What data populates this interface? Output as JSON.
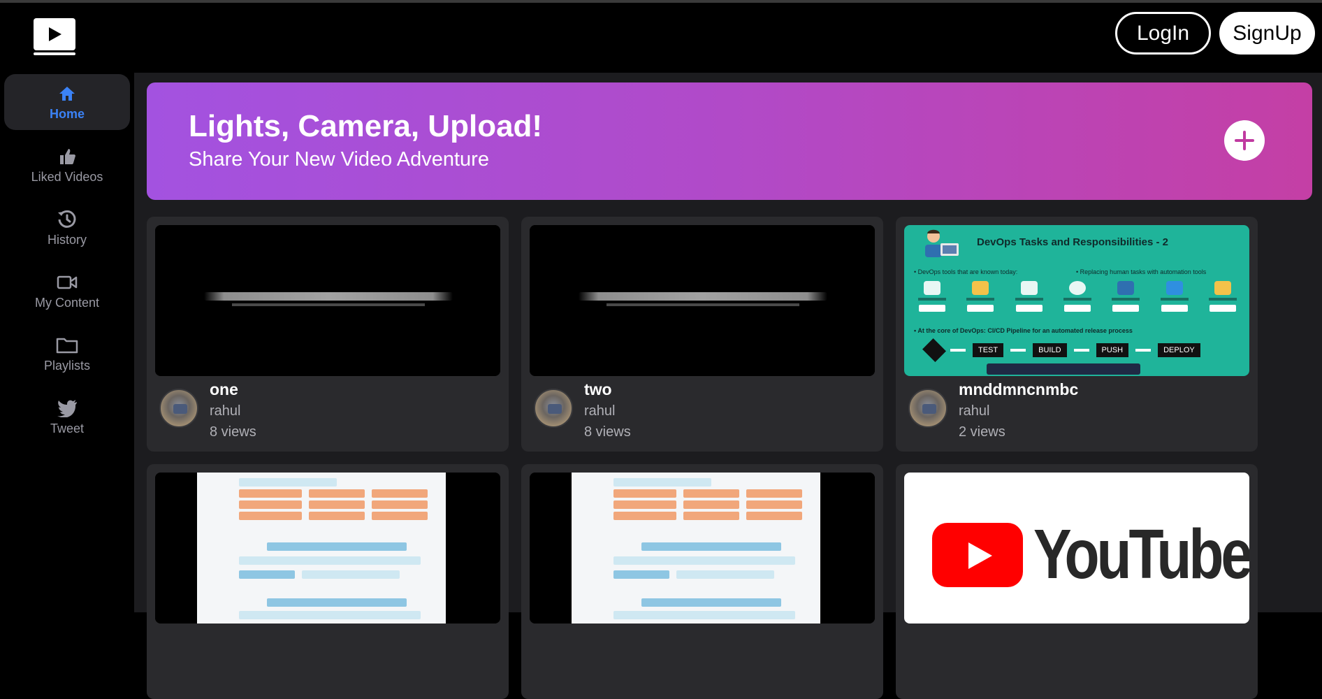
{
  "header": {
    "logo_icon": "play-icon",
    "login_label": "LogIn",
    "signup_label": "SignUp"
  },
  "sidebar": {
    "items": [
      {
        "label": "Home",
        "icon": "home-icon",
        "active": true
      },
      {
        "label": "Liked Videos",
        "icon": "thumbs-up-icon"
      },
      {
        "label": "History",
        "icon": "history-icon"
      },
      {
        "label": "My Content",
        "icon": "video-camera-icon"
      },
      {
        "label": "Playlists",
        "icon": "folder-icon"
      },
      {
        "label": "Tweet",
        "icon": "twitter-icon"
      }
    ]
  },
  "banner": {
    "title": "Lights, Camera, Upload!",
    "subtitle": "Share Your New Video Adventure",
    "action_icon": "plus-icon"
  },
  "videos": [
    {
      "title": "one",
      "channel": "rahul",
      "views": "8 views"
    },
    {
      "title": "two",
      "channel": "rahul",
      "views": "8 views"
    },
    {
      "title": "mnddmncnmbc",
      "channel": "rahul",
      "views": "2 views",
      "thumb_text": {
        "heading": "DevOps Tasks and Responsibilities - 2",
        "left": "DevOps tools that are known today:",
        "right": "Replacing human tasks with automation tools",
        "core": "At the core of DevOps: CI/CD Pipeline for an automated release process",
        "steps": [
          "TEST",
          "BUILD",
          "PUSH",
          "DEPLOY"
        ]
      }
    },
    {
      "title": "",
      "channel": "",
      "views": ""
    },
    {
      "title": "",
      "channel": "",
      "views": ""
    },
    {
      "title": "",
      "channel": "",
      "views": "",
      "thumb_text": {
        "brand": "YouTube"
      }
    }
  ],
  "colors": {
    "accent": "#3b82f6",
    "banner_start": "#a352e0",
    "banner_end": "#c43fa5",
    "card_bg": "#2a2a2d"
  }
}
